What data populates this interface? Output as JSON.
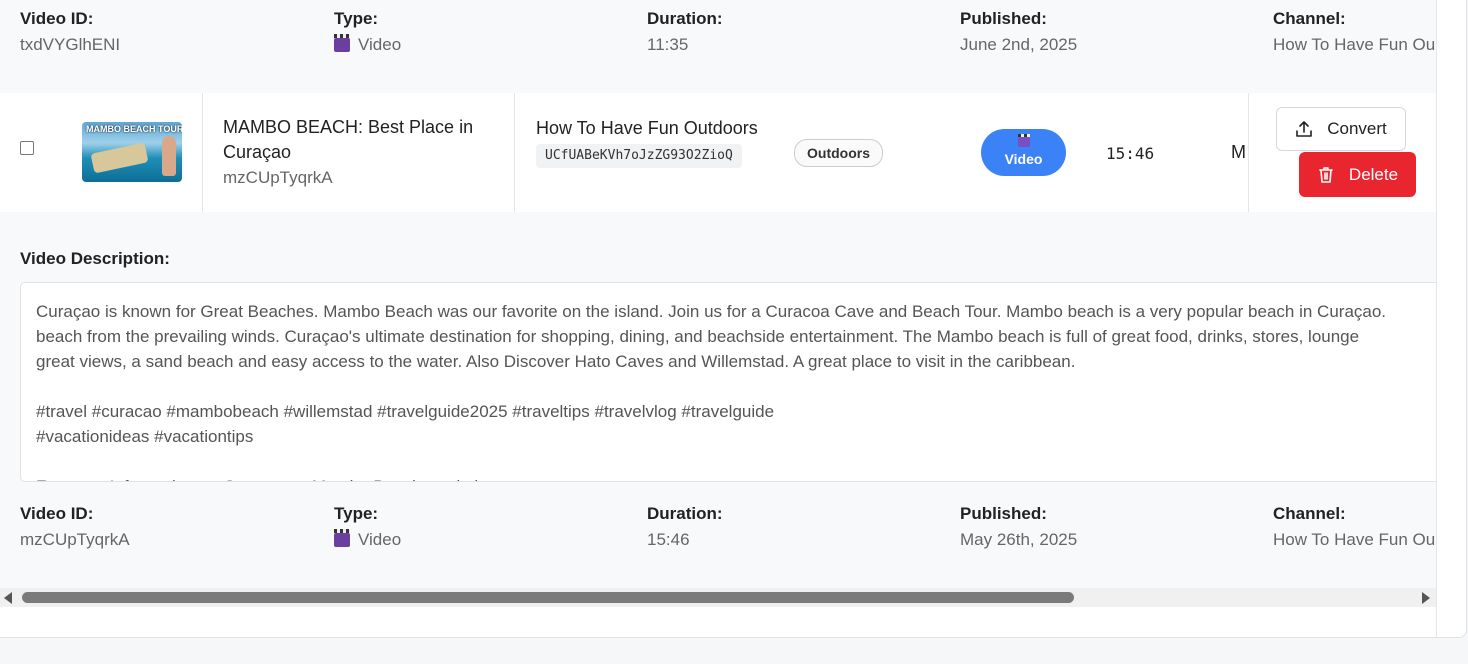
{
  "top_meta": {
    "video_id_label": "Video ID:",
    "video_id": "txdVYGlhENI",
    "type_label": "Type:",
    "type": "Video",
    "duration_label": "Duration:",
    "duration": "11:35",
    "published_label": "Published:",
    "published": "June 2nd, 2025",
    "channel_label": "Channel:",
    "channel": "How To Have Fun Ou"
  },
  "row": {
    "thumbnail_text": "MAMBO BEACH TOUR!",
    "title": "MAMBO BEACH: Best Place in Curaçao",
    "video_id": "mzCUpTyqrkA",
    "channel_name": "How To Have Fun Outdoors",
    "channel_id": "UCfUABeKVh7oJzZG93O2ZioQ",
    "tag": "Outdoors",
    "type_pill": "Video",
    "duration": "15:46",
    "truncated": "M",
    "convert_label": "Convert",
    "delete_label": "Delete"
  },
  "description": {
    "label": "Video Description:",
    "text": "Curaçao is known for Great Beaches. Mambo Beach was our favorite on the island. Join us for a Curacoa Cave and Beach Tour. Mambo beach is a very popular beach in Curaçao.\nbeach from the prevailing winds. Curaçao's ultimate destination for shopping, dining, and beachside entertainment. The Mambo beach is full of great food, drinks, stores, lounge\ngreat views, a sand beach and easy access to the water. Also Discover Hato Caves and Willemstad. A great place to visit in the caribbean.\n\n#travel #curacao #mambobeach #willemstad #travelguide2025 #traveltips #travelvlog #travelguide\n#vacationideas #vacationtips\n\nFor more Information on Curacao or Mambo Beach read above"
  },
  "bottom_meta": {
    "video_id_label": "Video ID:",
    "video_id": "mzCUpTyqrkA",
    "type_label": "Type:",
    "type": "Video",
    "duration_label": "Duration:",
    "duration": "15:46",
    "published_label": "Published:",
    "published": "May 26th, 2025",
    "channel_label": "Channel:",
    "channel": "How To Have Fun Ou"
  },
  "colors": {
    "delete": "#e9262f",
    "type_pill": "#3b82f6"
  }
}
